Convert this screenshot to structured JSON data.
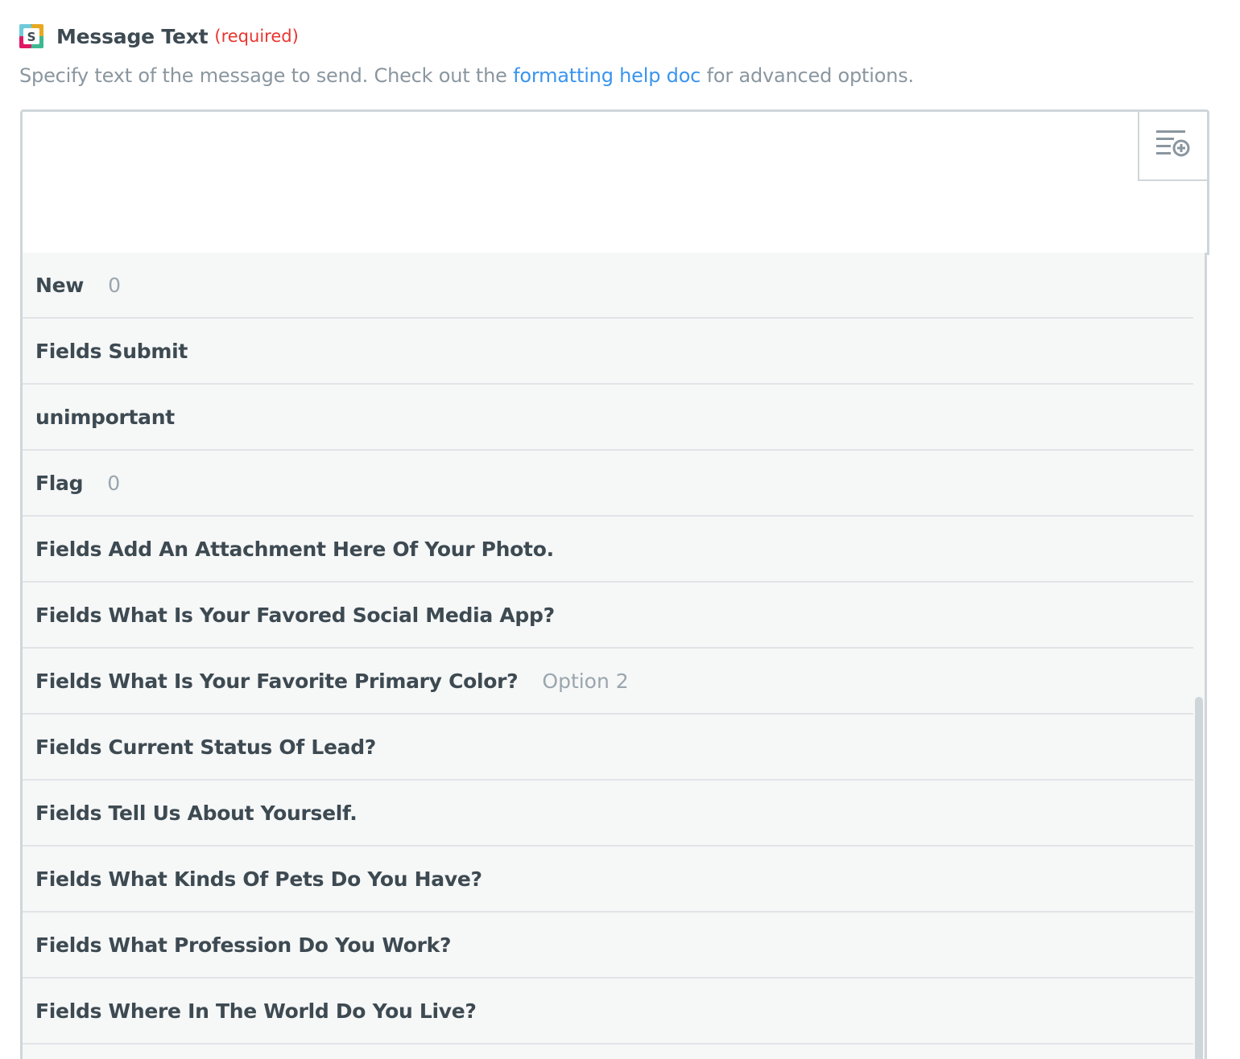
{
  "field": {
    "app_icon": "slack-logo-icon",
    "label": "Message Text",
    "required_label": "(required)",
    "required_color": "#e8352e"
  },
  "help": {
    "prefix": "Specify text of the message to send. Check out the ",
    "link_text": "formatting help doc",
    "suffix": " for advanced options.",
    "link_color": "#3a94ee"
  },
  "editor": {
    "value": "",
    "insert_button_icon": "insert-field-icon"
  },
  "dropdown": {
    "items": [
      {
        "label": "New",
        "value": "0"
      },
      {
        "label": "Fields Submit",
        "value": ""
      },
      {
        "label": "unimportant",
        "value": ""
      },
      {
        "label": "Flag",
        "value": "0"
      },
      {
        "label": "Fields Add An Attachment Here Of Your Photo.",
        "value": ""
      },
      {
        "label": "Fields What Is Your Favored Social Media App?",
        "value": ""
      },
      {
        "label": "Fields What Is Your Favorite Primary Color?",
        "value": "Option 2"
      },
      {
        "label": "Fields Current Status Of Lead?",
        "value": ""
      },
      {
        "label": "Fields Tell Us About Yourself.",
        "value": ""
      },
      {
        "label": "Fields What Kinds Of Pets Do You Have?",
        "value": ""
      },
      {
        "label": "Fields What Profession Do You Work?",
        "value": ""
      },
      {
        "label": "Fields Where In The World Do You Live?",
        "value": ""
      },
      {
        "label": "",
        "value": ""
      }
    ]
  }
}
